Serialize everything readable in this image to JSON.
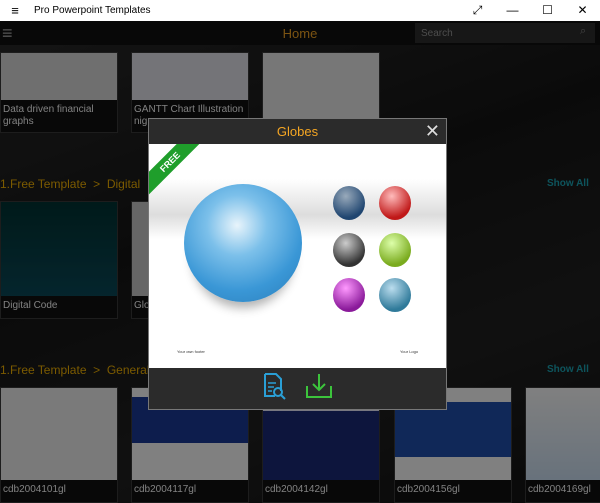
{
  "window": {
    "title": "Pro Powerpoint Templates",
    "menu_icon": "≡",
    "fullscreen": "⤢",
    "minimize": "—",
    "maximize": "☐",
    "close": "✕"
  },
  "appbar": {
    "title": "Home",
    "search_placeholder": "Search"
  },
  "row1": [
    {
      "caption": "Data driven financial graphs"
    },
    {
      "caption": "GANTT Chart Illustration nig"
    },
    {
      "caption": ""
    }
  ],
  "sections": [
    {
      "heading": "1.Free Template  >  Digital",
      "show_all": "Show All"
    },
    {
      "heading": "1.Free Template  >  General",
      "show_all": "Show All"
    }
  ],
  "row2": [
    {
      "caption": "Digital Code"
    },
    {
      "caption": "Glo"
    }
  ],
  "row3": [
    {
      "caption": "cdb2004101gl"
    },
    {
      "caption": "cdb2004117gl"
    },
    {
      "caption": "cdb2004142gl"
    },
    {
      "caption": "cdb2004156gl"
    },
    {
      "caption": "cdb2004169gl"
    }
  ],
  "modal": {
    "title": "Globes",
    "close": "✕",
    "badge": "FREE",
    "footer_left": "Your own footer",
    "footer_right": "Your Logo",
    "colors": {
      "accent": "#f5a623",
      "preview_icon": "#2a9fd6",
      "download_icon": "#3cc43c"
    }
  }
}
